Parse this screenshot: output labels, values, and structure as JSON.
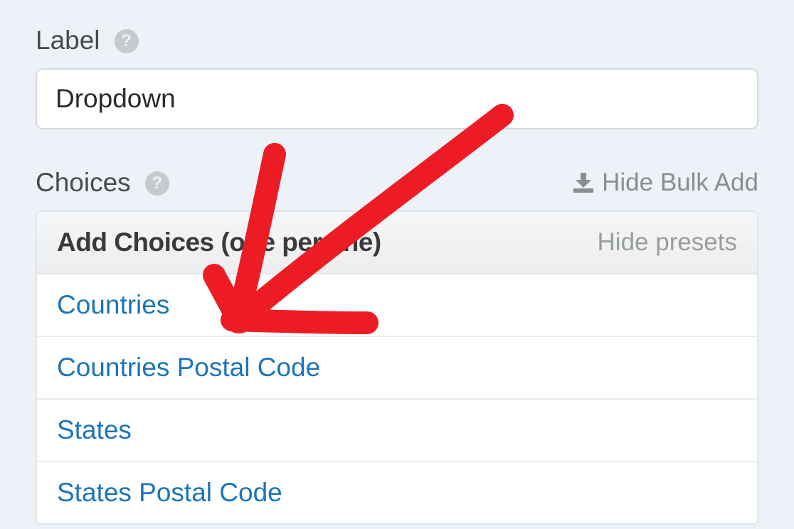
{
  "label": {
    "title": "Label",
    "value": "Dropdown"
  },
  "choices": {
    "title": "Choices",
    "hide_bulk": "Hide Bulk Add",
    "panel_title": "Add Choices (one per line)",
    "hide_presets": "Hide presets",
    "presets": [
      "Countries",
      "Countries Postal Code",
      "States",
      "States Postal Code"
    ]
  }
}
